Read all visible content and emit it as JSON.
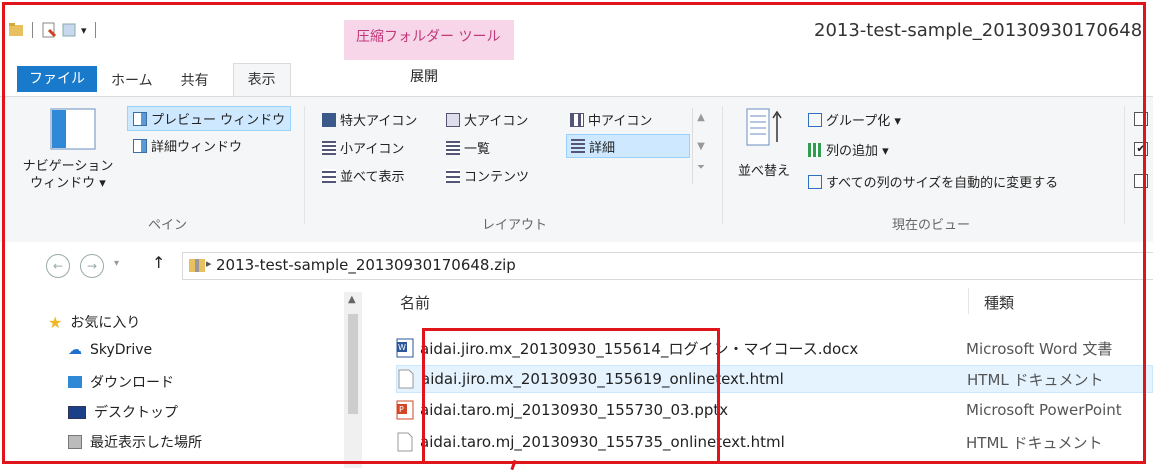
{
  "titlebar": {
    "context_tab": "圧縮フォルダー ツール",
    "window_title": "2013-test-sample_20130930170648"
  },
  "tabs": [
    "ファイル",
    "ホーム",
    "共有",
    "表示",
    "展開"
  ],
  "ribbon": {
    "pane": {
      "nav_pane_l1": "ナビゲーション",
      "nav_pane_l2": "ウィンドウ ▾",
      "preview": "プレビュー ウィンドウ",
      "details": "詳細ウィンドウ",
      "group": "ペイン"
    },
    "layout": {
      "xl_icons": "特大アイコン",
      "large_icons": "大アイコン",
      "medium_icons": "中アイコン",
      "small_icons": "小アイコン",
      "list": "一覧",
      "details": "詳細",
      "tiles": "並べて表示",
      "content": "コンテンツ",
      "group": "レイアウト"
    },
    "current_view": {
      "sort": "並べ替え",
      "group_by": "グループ化 ▾",
      "add_columns": "列の追加 ▾",
      "size_all": "すべての列のサイズを自動的に変更する",
      "group": "現在のビュー"
    }
  },
  "address": {
    "back": "←",
    "forward": "→",
    "up": "↑",
    "path": "2013-test-sample_20130930170648.zip"
  },
  "nav": {
    "favorites": "お気に入り",
    "items": [
      "SkyDrive",
      "ダウンロード",
      "デスクトップ",
      "最近表示した場所"
    ]
  },
  "files": {
    "col_name": "名前",
    "col_type": "種類",
    "rows": [
      {
        "name": "aidai.jiro.mx_20130930_155614_ログイン・マイコース.docx",
        "type": "Microsoft Word 文書",
        "icon": "word-icon"
      },
      {
        "name": "aidai.jiro.mx_20130930_155619_onlinetext.html",
        "type": "HTML ドキュメント",
        "icon": "html-file-icon"
      },
      {
        "name": "aidai.taro.mj_20130930_155730_03.pptx",
        "type": "Microsoft PowerPoint",
        "icon": "powerpoint-icon"
      },
      {
        "name": "aidai.taro.mj_20130930_155735_onlinetext.html",
        "type": "HTML ドキュメント",
        "icon": "html-file-icon"
      }
    ]
  },
  "colors": {
    "accent": "#1979ca",
    "context": "#f7d6ea",
    "annotation": "#e0151c"
  }
}
